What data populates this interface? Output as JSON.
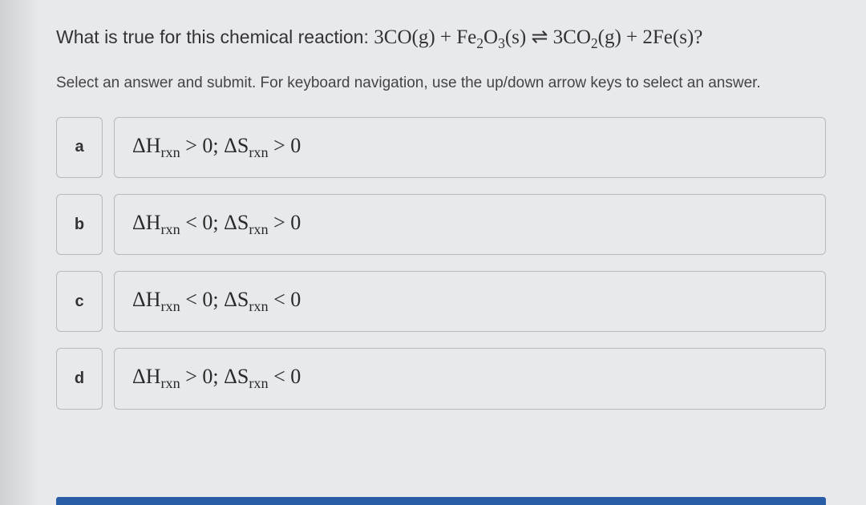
{
  "question": {
    "prefix": "What is true for this chemical reaction: ",
    "equation": "3CO(g) + Fe₂O₃(s) ⇌ 3CO₂(g) + 2Fe(s)?"
  },
  "instruction": "Select an answer and submit. For keyboard navigation, use the up/down arrow keys to select an answer.",
  "options": [
    {
      "label": "a",
      "text": "ΔHrxn > 0; ΔSrxn > 0"
    },
    {
      "label": "b",
      "text": "ΔHrxn < 0; ΔSrxn > 0"
    },
    {
      "label": "c",
      "text": "ΔHrxn < 0; ΔSrxn < 0"
    },
    {
      "label": "d",
      "text": "ΔHrxn > 0; ΔSrxn < 0"
    }
  ]
}
